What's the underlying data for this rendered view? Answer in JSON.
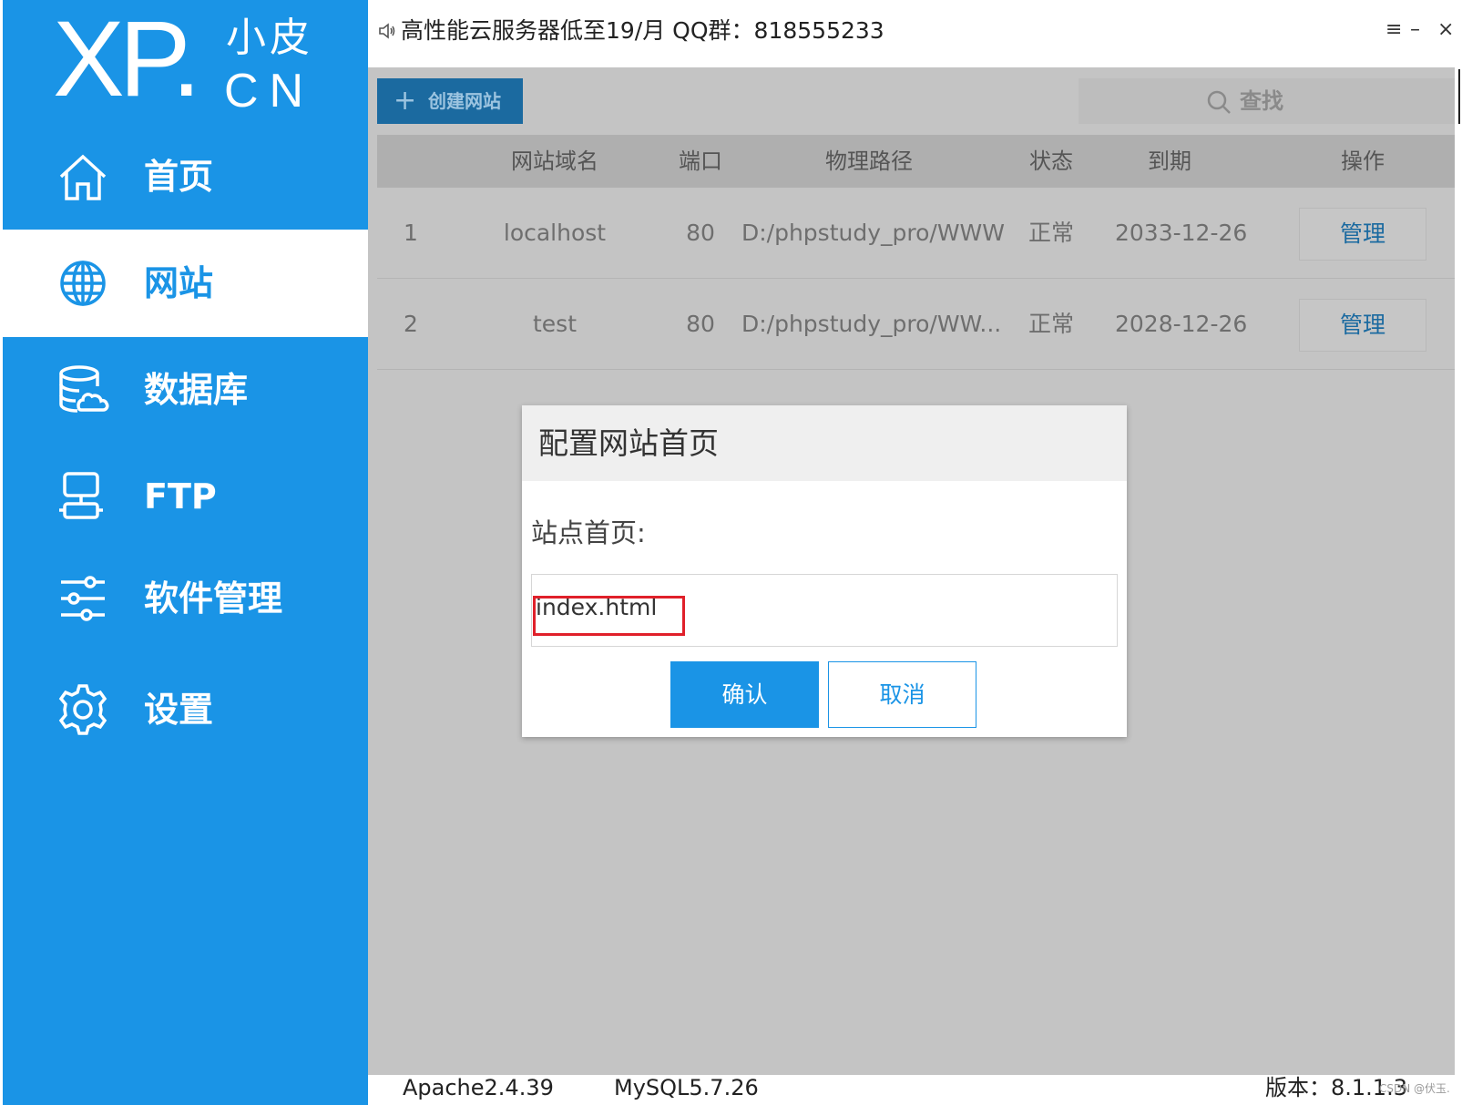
{
  "logo": {
    "brand": "XP.",
    "cn_top": "小皮",
    "cn_bottom": "CN"
  },
  "sidebar": {
    "items": [
      {
        "label": "首页",
        "icon": "home-icon",
        "active": false
      },
      {
        "label": "网站",
        "icon": "globe-icon",
        "active": true
      },
      {
        "label": "数据库",
        "icon": "database-icon",
        "active": false
      },
      {
        "label": "FTP",
        "icon": "server-icon",
        "active": false
      },
      {
        "label": "软件管理",
        "icon": "sliders-icon",
        "active": false
      },
      {
        "label": "设置",
        "icon": "gear-icon",
        "active": false
      }
    ]
  },
  "titlebar": {
    "notice": "高性能云服务器低至19/月  QQ群：818555233",
    "menu_glyph": "≡",
    "minimize_glyph": "–",
    "close_glyph": "×"
  },
  "toolbar": {
    "create_label": "创建网站",
    "search_label": "查找"
  },
  "table": {
    "headers": [
      "网站域名",
      "端口",
      "物理路径",
      "状态",
      "到期",
      "操作"
    ],
    "rows": [
      {
        "index": "1",
        "domain": "localhost",
        "port": "80",
        "path": "D:/phpstudy_pro/WWW",
        "status": "正常",
        "expire": "2033-12-26",
        "action": "管理"
      },
      {
        "index": "2",
        "domain": "test",
        "port": "80",
        "path": "D:/phpstudy_pro/WW...",
        "status": "正常",
        "expire": "2028-12-26",
        "action": "管理"
      }
    ]
  },
  "dialog": {
    "title": "配置网站首页",
    "field_label": "站点首页:",
    "field_value": "index.html",
    "ok_label": "确认",
    "cancel_label": "取消"
  },
  "footer": {
    "apache": "Apache2.4.39",
    "mysql": "MySQL5.7.26",
    "version": "版本：8.1.1.3"
  },
  "watermark": "CSDN @伏玉.",
  "colors": {
    "brand_blue": "#1a94e6",
    "highlight_red": "#e0202a",
    "overlay_gray": "#c4c4c4"
  }
}
